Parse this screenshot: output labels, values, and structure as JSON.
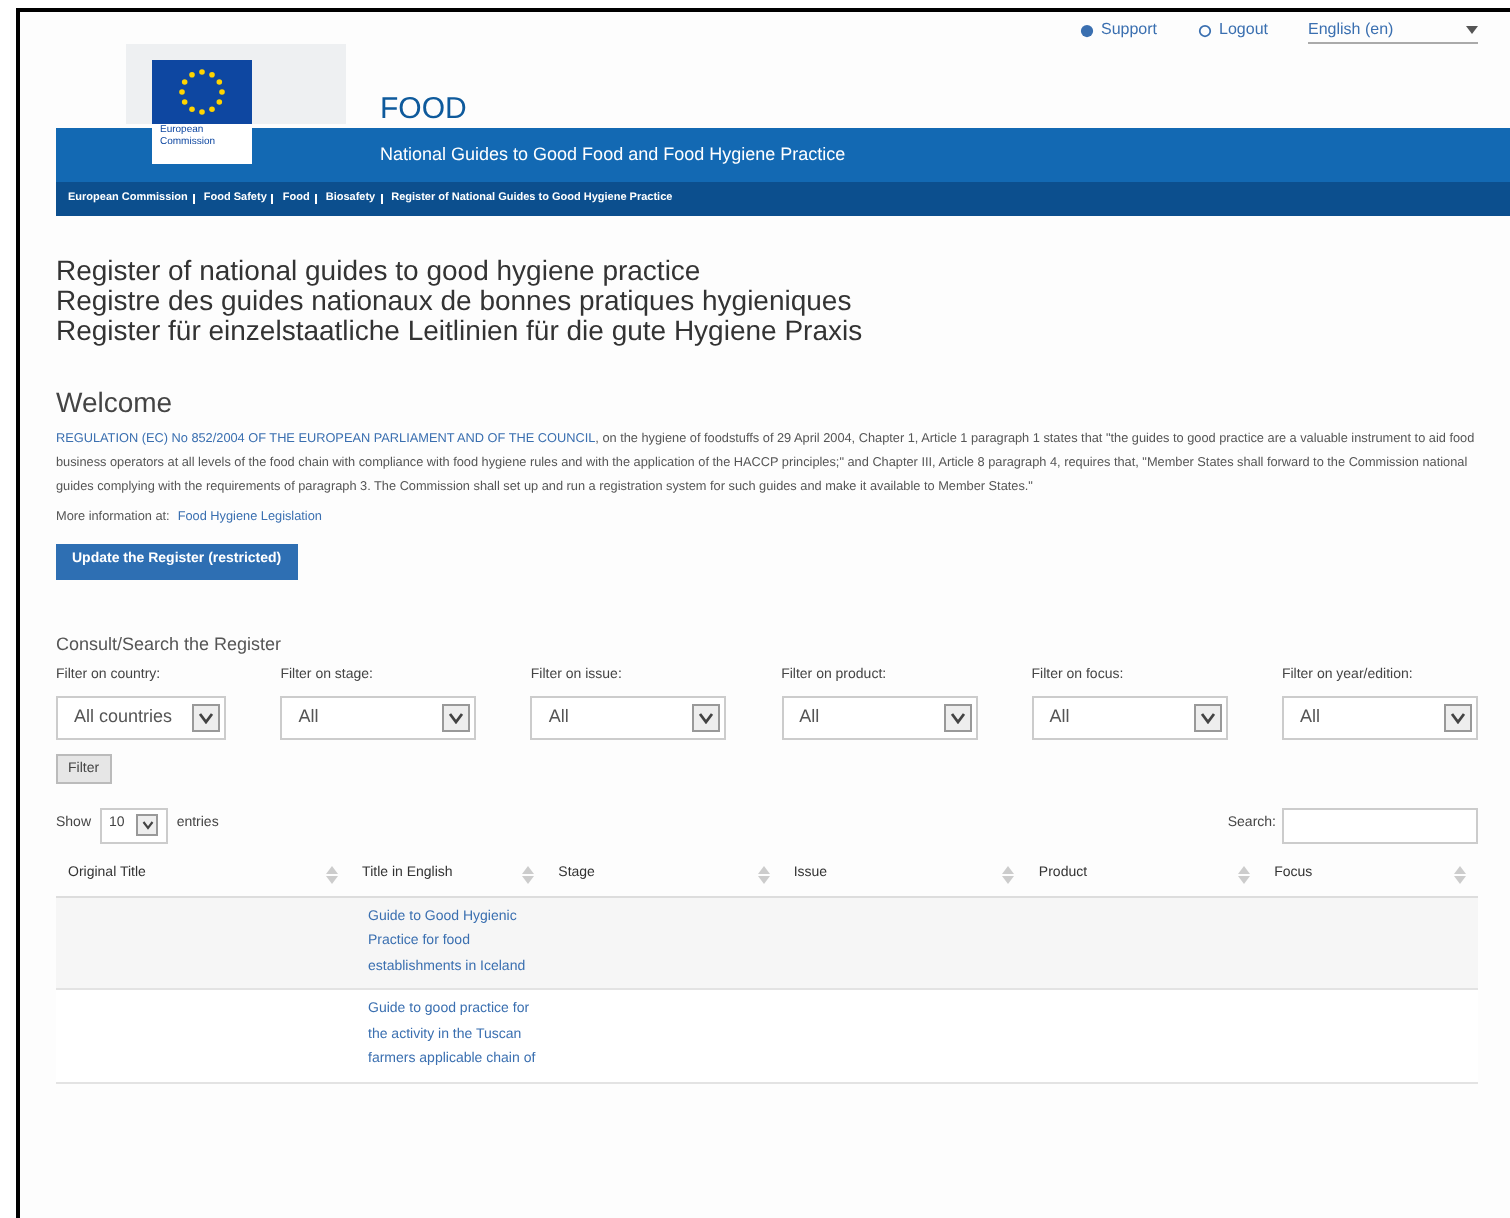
{
  "top_links": [
    {
      "kind": "support",
      "label": "Support"
    },
    {
      "kind": "logout",
      "label": "Logout"
    }
  ],
  "language": {
    "value": "English (en)"
  },
  "logo": {
    "caption": "European Commission"
  },
  "site_title": "FOOD",
  "site_subtitle": "National Guides to Good Food and Food Hygiene Practice",
  "breadcrumb": [
    "European Commission",
    "Food Safety",
    "Food",
    "Biosafety",
    "Register of National Guides to Good Hygiene Practice"
  ],
  "page_titles": [
    "Register of national guides to good hygiene practice",
    "Registre des guides nationaux de bonnes pratiques hygieniques",
    "Register für einzelstaatliche Leitlinien für die gute Hygiene Praxis"
  ],
  "welcome": {
    "heading": "Welcome",
    "link": "REGULATION (EC) No 852/2004 OF THE EUROPEAN PARLIAMENT AND OF THE COUNCIL",
    "text": ", on the hygiene of foodstuffs of 29 April 2004, Chapter 1, Article 1 paragraph 1 states that \"the guides to good practice are a valuable instrument to aid food business operators at all levels of the food chain with compliance with food hygiene rules and with the application of the HACCP principles;\" and Chapter III, Article 8 paragraph 4, requires that, \"Member States shall forward to the Commission national guides complying with the requirements of paragraph 3. The Commission shall set up and run a registration system for such guides and make it available to Member States.\"",
    "more_label": "More information at:",
    "more_link": "Food Hygiene Legislation",
    "button": "Update the Register (restricted)"
  },
  "search_section": {
    "heading": "Consult/Search the Register",
    "filters": [
      {
        "label": "Filter on country:",
        "value": "All countries"
      },
      {
        "label": "Filter on stage:",
        "value": "All"
      },
      {
        "label": "Filter on issue:",
        "value": "All"
      },
      {
        "label": "Filter on product:",
        "value": "All"
      },
      {
        "label": "Filter on focus:",
        "value": "All"
      },
      {
        "label": "Filter on year/edition:",
        "value": "All"
      }
    ],
    "filter_button": "Filter"
  },
  "table_controls": {
    "show_label": "Show",
    "entries_value": "10",
    "entries_label": "entries",
    "search_label": "Search:"
  },
  "table": {
    "columns": [
      "Original Title",
      "Title in English",
      "Stage",
      "Issue",
      "Product",
      "Focus"
    ],
    "rows": [
      {
        "title_en": "Guide to Good Hygienic Practice for food establishments in Iceland"
      },
      {
        "title_en": "Guide to good practice for the activity in the Tuscan farmers applicable chain of"
      }
    ]
  }
}
